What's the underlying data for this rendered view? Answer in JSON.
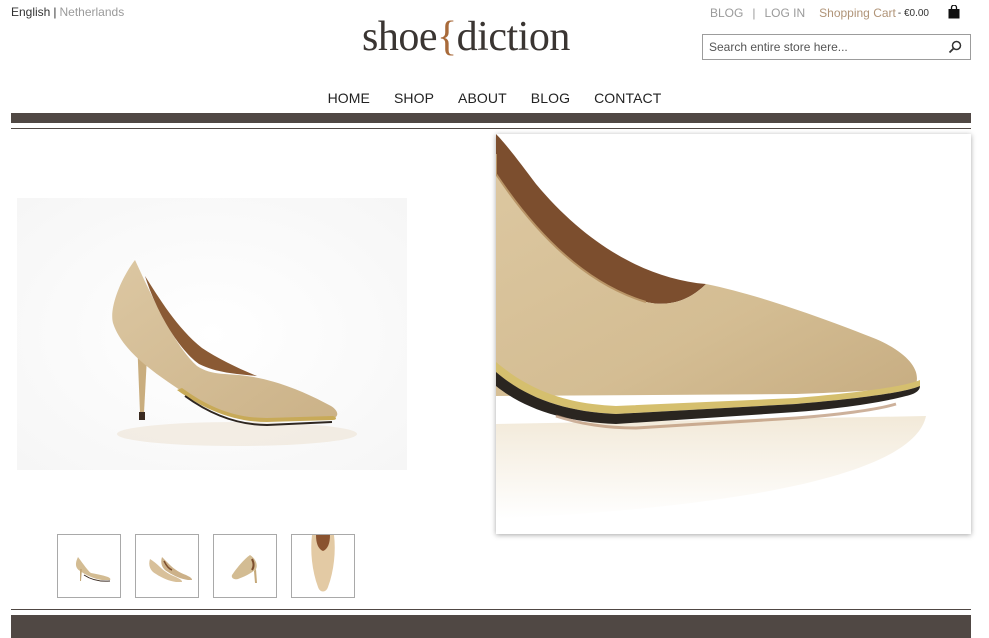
{
  "language": {
    "current": "English",
    "separator": "|",
    "other": "Netherlands"
  },
  "brand": {
    "part1": "shoe",
    "brace": "{",
    "part2": "diction"
  },
  "header_links": {
    "blog": "BLOG",
    "separator": "|",
    "login": "LOG IN",
    "cart_label": "Shopping Cart",
    "cart_sep": " - ",
    "cart_total": "€0.00"
  },
  "search": {
    "placeholder": "Search entire store here..."
  },
  "nav": {
    "home": "HOME",
    "shop": "SHOP",
    "about": "ABOUT",
    "blog": "BLOG",
    "contact": "CONTACT"
  },
  "colors": {
    "bar": "#504844",
    "brand_accent": "#a86a3a",
    "cart_link": "#b09478",
    "shoe": "#d8c29c"
  }
}
